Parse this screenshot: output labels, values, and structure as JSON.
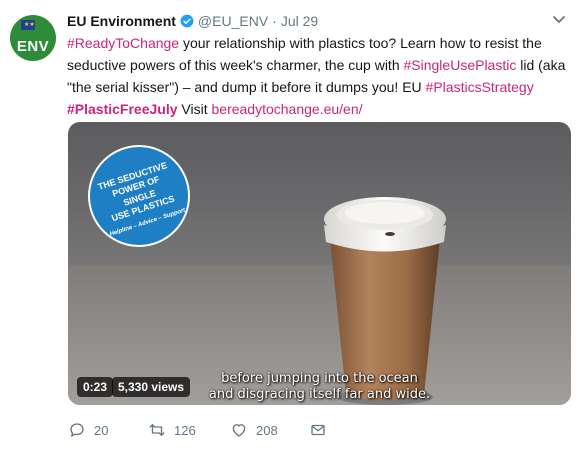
{
  "account": {
    "name": "EU Environment",
    "handle": "@EU_ENV",
    "separator": "·",
    "date": "Jul 29",
    "avatar_text": "ENV",
    "verified_icon": "verified-badge-icon"
  },
  "tweet": {
    "line1": [
      "#ReadyToChange",
      " your relationship with plastics too? Learn how to resist the"
    ],
    "line2": [
      "seductive powers of this week's charmer, the cup with ",
      "#SingleUsePlastic",
      " lid (aka"
    ],
    "line3": "\"the serial kisser\") – and dump it before it dumps you! EU ",
    "line3_tag": "#PlasticsStrategy",
    "line4_tag": "#PlasticFreeJuly",
    "line4_text": " Visit ",
    "line4_link": "bereadytochange.eu/en/"
  },
  "video": {
    "duration": "0:23",
    "views": "5,330 views",
    "subtitle_line1": "before jumping into the ocean",
    "subtitle_line2": "and disgracing itself far and wide.",
    "badge_lines": [
      "THE SEDUCTIVE",
      "POWER OF",
      "SINGLE",
      "USE PLASTICS",
      "Helpline – Advice – Support"
    ]
  },
  "actions": {
    "reply_count": "20",
    "retweet_count": "126",
    "like_count": "208"
  },
  "colors": {
    "link": "#1b95e0",
    "hashtag_pink": "#c8267a",
    "muted": "#657786",
    "avatar_green": "#2e8b3a"
  }
}
